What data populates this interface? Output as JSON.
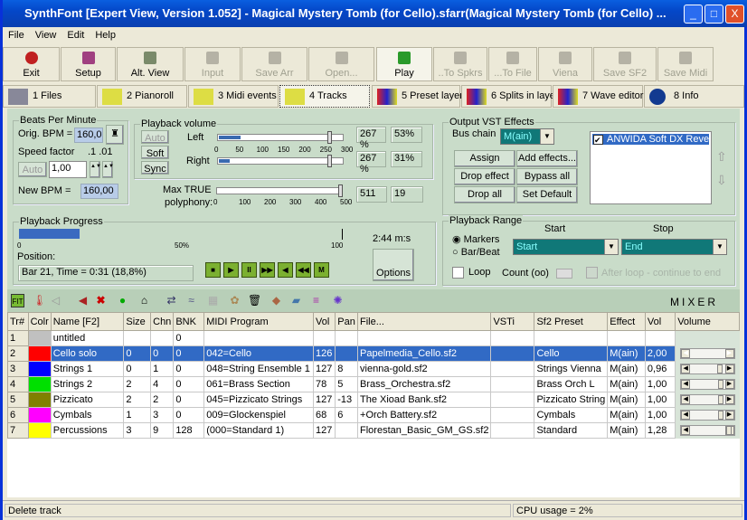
{
  "window": {
    "title": "SynthFont [Expert View, Version 1.052] - Magical Mystery Tomb (for Cello).sfarr(Magical Mystery Tomb (for Cello) ...",
    "min": "_",
    "max": "□",
    "close": "X"
  },
  "menu": [
    "File",
    "View",
    "Edit",
    "Help"
  ],
  "toolbar": [
    "Exit",
    "Setup",
    "Alt. View",
    "Input",
    "Save Arr",
    "Open...",
    "Play",
    "..To Spkrs",
    "...To File",
    "Viena",
    "Save SF2",
    "Save Midi"
  ],
  "tabs": [
    "1 Files",
    "2 Pianoroll",
    "3 Midi events",
    "4 Tracks",
    "5 Preset layers",
    "6 Splits in layer",
    "7 Wave editor",
    "8 Info"
  ],
  "bpm": {
    "caption": "Beats Per Minute",
    "orig_label": "Orig. BPM =",
    "orig": "160,0",
    "speed_label": "Speed factor",
    "speed_steps": ".1 .01",
    "auto": "Auto",
    "speed": "1,00",
    "new_label": "New BPM =",
    "new": "160,00"
  },
  "volume": {
    "caption": "Playback volume",
    "auto": "Auto",
    "soft": "Soft",
    "sync": "Sync",
    "left": "Left",
    "right": "Right",
    "scale": [
      "0",
      "50",
      "100",
      "150",
      "200",
      "250",
      "300"
    ],
    "left_pct": "267 %",
    "left_level": "53%",
    "right_pct": "267 %",
    "right_level": "31%",
    "left_value": 267,
    "right_value": 267,
    "poly_label1": "Max TRUE",
    "poly_label2": "polyphony:",
    "poly_scale": [
      "0",
      "100",
      "200",
      "300",
      "400",
      "500"
    ],
    "poly": "511",
    "poly_used": "19"
  },
  "progress": {
    "caption": "Playback Progress",
    "fraction": 0.188,
    "scale_start": "0",
    "scale_mid": "50%",
    "scale_end": "100",
    "duration": "2:44 m:s",
    "position_label": "Position:",
    "position": "Bar 21, Time = 0:31 (18,8%)",
    "options": "Options"
  },
  "vst": {
    "caption": "Output VST Effects",
    "bus_label": "Bus chain",
    "bus": "M(ain)",
    "buttons": [
      "Assign",
      "Add effects...",
      "Drop effect",
      "Bypass all",
      "Drop all",
      "Set Default"
    ],
    "effects": [
      "ANWIDA Soft DX Reve"
    ]
  },
  "range": {
    "caption": "Playback Range",
    "start_label": "Start",
    "stop_label": "Stop",
    "markers": "Markers",
    "barbeat": "Bar/Beat",
    "start": "Start",
    "stop": "End",
    "loop": "Loop",
    "count": "Count (oo)",
    "after": "After loop - continue to end"
  },
  "mixer": {
    "label": "MIXER"
  },
  "table": {
    "headers": [
      "Tr#",
      "Colr",
      "Name [F2]",
      "Size",
      "Chn",
      "BNK",
      "MIDI Program",
      "Vol",
      "Pan",
      "File...",
      "VSTi",
      "Sf2 Preset",
      "Effect",
      "Vol",
      "Volume"
    ],
    "rows": [
      {
        "tr": "1",
        "color": "#c0c0c0",
        "name": "untitled",
        "size": "",
        "chn": "",
        "bnk": "0",
        "program": "",
        "vol": "",
        "pan": "",
        "file": "",
        "vsti": "",
        "preset": "",
        "effect": "",
        "gain": "",
        "slider": null
      },
      {
        "tr": "2",
        "color": "#ff0000",
        "name": "Cello solo",
        "size": "0",
        "chn": "0",
        "bnk": "0",
        "program": "042=Cello",
        "vol": "126",
        "pan": "",
        "file": "Papelmedia_Cello.sf2",
        "vsti": "",
        "preset": "Cello",
        "effect": "M(ain)",
        "gain": "2,00",
        "slider": 1.0
      },
      {
        "tr": "3",
        "color": "#0000ff",
        "name": "Strings 1",
        "size": "0",
        "chn": "1",
        "bnk": "0",
        "program": "048=String Ensemble 1",
        "vol": "127",
        "pan": "8",
        "file": "vienna-gold.sf2",
        "vsti": "",
        "preset": "Strings Vienna",
        "effect": "M(ain)",
        "gain": "0,96",
        "slider": 0.48
      },
      {
        "tr": "4",
        "color": "#00e000",
        "name": "Strings 2",
        "size": "2",
        "chn": "4",
        "bnk": "0",
        "program": "061=Brass Section",
        "vol": "78",
        "pan": "5",
        "file": "Brass_Orchestra.sf2",
        "vsti": "",
        "preset": "Brass Orch L",
        "effect": "M(ain)",
        "gain": "1,00",
        "slider": 0.5
      },
      {
        "tr": "5",
        "color": "#808000",
        "name": "Pizzicato",
        "size": "2",
        "chn": "2",
        "bnk": "0",
        "program": "045=Pizzicato Strings",
        "vol": "127",
        "pan": "-13",
        "file": "The Xioad Bank.sf2",
        "vsti": "",
        "preset": "Pizzicato String",
        "effect": "M(ain)",
        "gain": "1,00",
        "slider": 0.5
      },
      {
        "tr": "6",
        "color": "#ff00ff",
        "name": "Cymbals",
        "size": "1",
        "chn": "3",
        "bnk": "0",
        "program": "009=Glockenspiel",
        "vol": "68",
        "pan": "6",
        "file": "+Orch Battery.sf2",
        "vsti": "",
        "preset": "Cymbals",
        "effect": "M(ain)",
        "gain": "1,00",
        "slider": 0.5
      },
      {
        "tr": "7",
        "color": "#ffff00",
        "name": "Percussions",
        "size": "3",
        "chn": "9",
        "bnk": "128",
        "program": "(000=Standard 1)",
        "vol": "127",
        "pan": "",
        "file": "Florestan_Basic_GM_GS.sf2",
        "vsti": "",
        "preset": "Standard",
        "effect": "M(ain)",
        "gain": "1,28",
        "slider": 0.64
      }
    ]
  },
  "status": {
    "left": "Delete track",
    "cpu": "CPU usage = 2%"
  }
}
